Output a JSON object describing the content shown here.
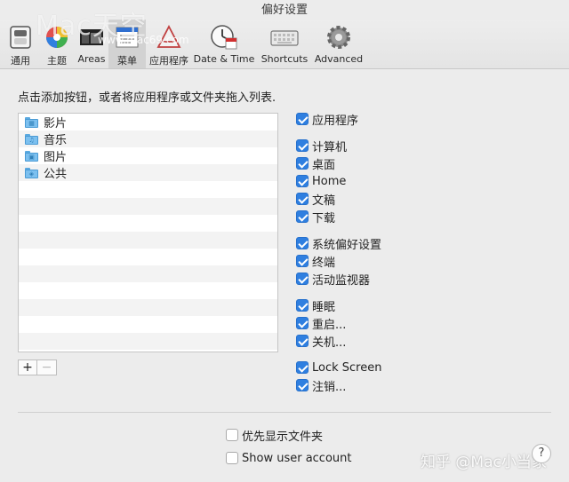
{
  "window": {
    "title": "偏好设置"
  },
  "toolbar": {
    "items": [
      {
        "label": "通用",
        "icon": "switch-icon"
      },
      {
        "label": "主题",
        "icon": "color-wheel-icon"
      },
      {
        "label": "Areas",
        "icon": "areas-icon"
      },
      {
        "label": "菜单",
        "icon": "menu-icon",
        "active": true
      },
      {
        "label": "应用程序",
        "icon": "app-icon"
      },
      {
        "label": "Date & Time",
        "icon": "clock-icon"
      },
      {
        "label": "Shortcuts",
        "icon": "keyboard-icon"
      },
      {
        "label": "Advanced",
        "icon": "gear-icon"
      }
    ]
  },
  "watermark": {
    "brand": "Mac天空",
    "url": "www.mac69.com"
  },
  "main": {
    "instruction": "点击添加按钮，或者将应用程序或文件夹拖入列表.",
    "folders": [
      {
        "name": "影片",
        "icon": "movies-folder-icon",
        "glyph": "▦"
      },
      {
        "name": "音乐",
        "icon": "music-folder-icon",
        "glyph": "♫"
      },
      {
        "name": "图片",
        "icon": "pictures-folder-icon",
        "glyph": "▣"
      },
      {
        "name": "公共",
        "icon": "public-folder-icon",
        "glyph": "◈"
      }
    ],
    "add_label": "+",
    "remove_label": "−"
  },
  "options": [
    {
      "label": "应用程序",
      "checked": true
    },
    {
      "label": "计算机",
      "checked": true
    },
    {
      "label": "桌面",
      "checked": true
    },
    {
      "label": "Home",
      "checked": true
    },
    {
      "label": "文稿",
      "checked": true
    },
    {
      "label": "下载",
      "checked": true
    },
    {
      "label": "系统偏好设置",
      "checked": true
    },
    {
      "label": "终端",
      "checked": true
    },
    {
      "label": "活动监视器",
      "checked": true
    },
    {
      "label": "睡眠",
      "checked": true
    },
    {
      "label": "重启...",
      "checked": true
    },
    {
      "label": "关机...",
      "checked": true
    },
    {
      "label": "Lock Screen",
      "checked": true
    },
    {
      "label": "注销...",
      "checked": true
    }
  ],
  "bottom": {
    "show_folders_first": {
      "label": "优先显示文件夹",
      "checked": false
    },
    "show_user_account": {
      "label": "Show user account",
      "checked": false
    },
    "help_label": "?"
  },
  "overlay": {
    "zhihu": "知乎 @Mac小当家"
  },
  "colors": {
    "checkbox_accent": "#2f7fe0",
    "folder_blue": "#7cc0ef"
  }
}
